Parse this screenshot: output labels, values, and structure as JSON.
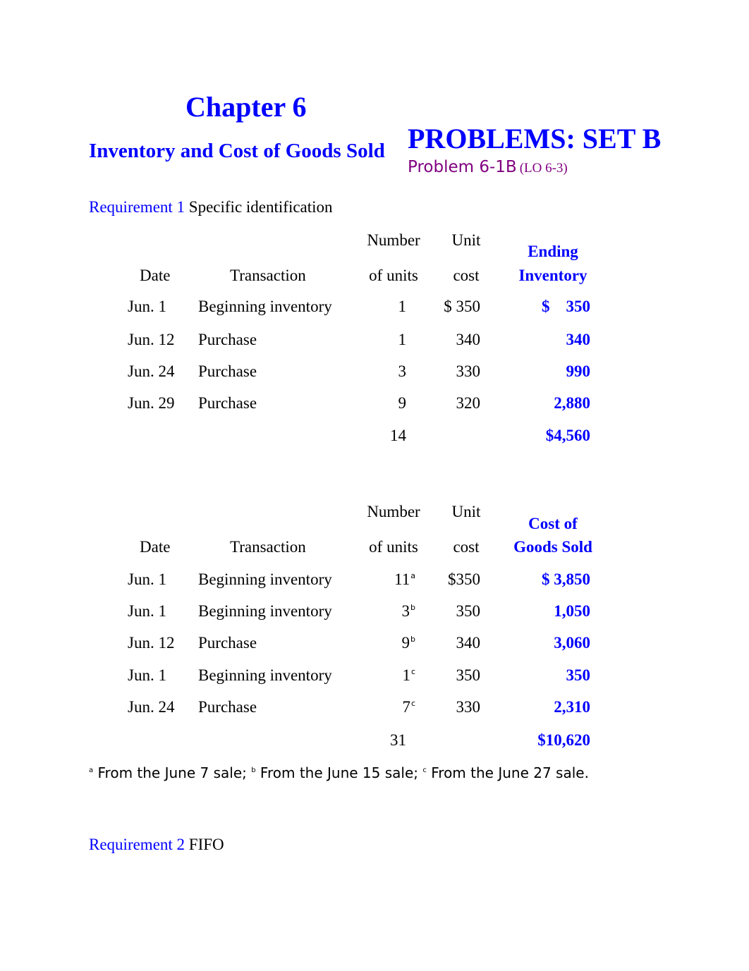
{
  "header": {
    "chapter": "Chapter 6",
    "subtitle": "Inventory and Cost of Goods Sold",
    "set_title": "PROBLEMS: SET B",
    "problem": "Problem 6-1B",
    "learning_objective": "(LO 6-3)"
  },
  "requirement1": {
    "label": "Requirement 1",
    "method": "Specific identification"
  },
  "table1": {
    "headers": {
      "date": "Date",
      "transaction": "Transaction",
      "units_line1": "Number",
      "units_line2": "of units",
      "cost_line1": "Unit",
      "cost_line2": "cost",
      "value_line1": "Ending",
      "value_line2": "Inventory"
    },
    "rows": [
      {
        "date": "Jun. 1",
        "transaction": "Beginning inventory",
        "units": "1",
        "cost": "$ 350",
        "value": "$    350"
      },
      {
        "date": "Jun. 12",
        "transaction": "Purchase",
        "units": "1",
        "cost": "340",
        "value": "340"
      },
      {
        "date": "Jun. 24",
        "transaction": "Purchase",
        "units": "3",
        "cost": "330",
        "value": "990"
      },
      {
        "date": "Jun. 29",
        "transaction": "Purchase",
        "units": "9",
        "cost": "320",
        "value": "2,880"
      }
    ],
    "total_units": "14",
    "total_value": "$4,560"
  },
  "table2": {
    "headers": {
      "date": "Date",
      "transaction": "Transaction",
      "units_line1": "Number",
      "units_line2": "of units",
      "cost_line1": "Unit",
      "cost_line2": "cost",
      "value_line1": "Cost of",
      "value_line2": "Goods Sold"
    },
    "rows": [
      {
        "date": "Jun. 1",
        "transaction": "Beginning inventory",
        "units": "11",
        "note": "a",
        "cost": "$350",
        "value": "$ 3,850"
      },
      {
        "date": "Jun. 1",
        "transaction": "Beginning inventory",
        "units": "3",
        "note": "b",
        "cost": "350",
        "value": "1,050"
      },
      {
        "date": "Jun. 12",
        "transaction": "Purchase",
        "units": "9",
        "note": "b",
        "cost": "340",
        "value": "3,060"
      },
      {
        "date": "Jun. 1",
        "transaction": "Beginning inventory",
        "units": "1",
        "note": "c",
        "cost": "350",
        "value": "350"
      },
      {
        "date": "Jun. 24",
        "transaction": "Purchase",
        "units": "7",
        "note": "c",
        "cost": "330",
        "value": "2,310"
      }
    ],
    "total_units": "31",
    "total_value": "$10,620"
  },
  "footnotes": [
    {
      "mark": "a",
      "text": " From the June 7 sale; "
    },
    {
      "mark": "b",
      "text": " From the June 15 sale; "
    },
    {
      "mark": "c",
      "text": " From the June 27 sale."
    }
  ],
  "requirement2": {
    "label": "Requirement 2",
    "method": "FIFO"
  }
}
